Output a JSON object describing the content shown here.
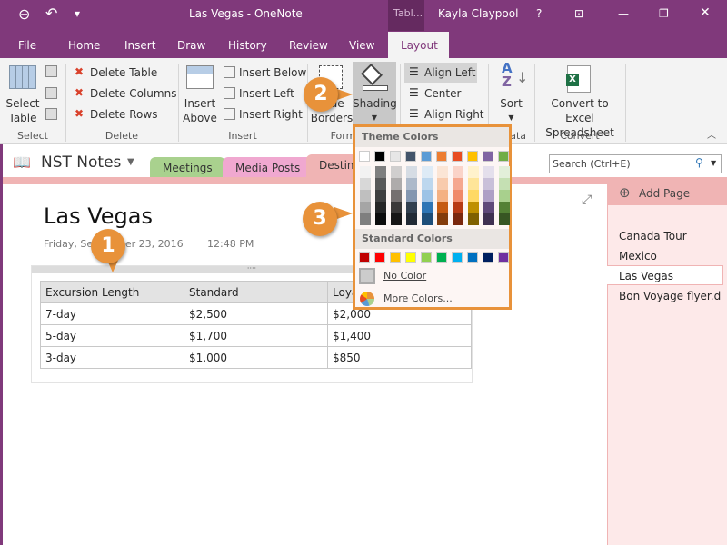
{
  "titlebar": {
    "title": "Las Vegas - OneNote",
    "context_tab": "Tabl...",
    "user": "Kayla Claypool",
    "help": "?"
  },
  "menu": [
    "File",
    "Home",
    "Insert",
    "Draw",
    "History",
    "Review",
    "View",
    "Layout"
  ],
  "ribbon": {
    "select": {
      "button": "Select Table",
      "group": "Select"
    },
    "delete": {
      "items": [
        "Delete Table",
        "Delete Columns",
        "Delete Rows"
      ],
      "group": "Delete"
    },
    "insert": {
      "above": "Insert Above",
      "items": [
        "Insert Below",
        "Insert Left",
        "Insert Right"
      ],
      "group": "Insert"
    },
    "format": {
      "borders": "Hide Borders",
      "shading": "Shading",
      "group": "Format"
    },
    "alignment": [
      "Align Left",
      "Center",
      "Align Right"
    ],
    "data": {
      "sort": "Sort",
      "group": "Data"
    },
    "convert": {
      "button": "Convert to Excel Spreadsheet",
      "group": "Convert"
    }
  },
  "notebook": {
    "name": "NST Notes",
    "sections": [
      "Meetings",
      "Media Posts",
      "Destinations"
    ],
    "search_placeholder": "Search (Ctrl+E)"
  },
  "page": {
    "title": "Las Vegas",
    "date": "Friday, September 23, 2016",
    "time": "12:48 PM"
  },
  "table": {
    "headers": [
      "Excursion Length",
      "Standard",
      "Loyalty"
    ],
    "rows": [
      [
        "7-day",
        "$2,500",
        "$2,000"
      ],
      [
        "5-day",
        "$1,700",
        "$1,400"
      ],
      [
        "3-day",
        "$1,000",
        "$850"
      ]
    ]
  },
  "pages": {
    "add": "Add Page",
    "items": [
      "Canada Tour",
      "Mexico",
      "Las Vegas",
      "Bon Voyage flyer.d"
    ],
    "selected": "Las Vegas"
  },
  "shading_menu": {
    "theme_label": "Theme Colors",
    "standard_label": "Standard Colors",
    "no_color": "No Color",
    "more_colors": "More Colors...",
    "theme": [
      "#ffffff",
      "#000000",
      "#e7e6e6",
      "#44546a",
      "#5b9bd5",
      "#ed7d31",
      "#e84c22",
      "#ffc000",
      "#8064a2",
      "#70ad47"
    ],
    "shades": [
      [
        "#f2f2f2",
        "#7f7f7f",
        "#d0cece",
        "#d6dce4",
        "#deebf6",
        "#fbe5d5",
        "#fad3c8",
        "#fff2cc",
        "#e4dfec",
        "#e2efd9"
      ],
      [
        "#d8d8d8",
        "#595959",
        "#aeabab",
        "#adb9ca",
        "#bdd7ee",
        "#f8cbad",
        "#f5a78f",
        "#fee599",
        "#c9c0d9",
        "#c5e0b3"
      ],
      [
        "#bfbfbf",
        "#3f3f3f",
        "#757070",
        "#8496b0",
        "#9dc3e6",
        "#f4b183",
        "#f08a6a",
        "#ffd965",
        "#ae9fc6",
        "#a8d08d"
      ],
      [
        "#a5a5a5",
        "#262626",
        "#3a3838",
        "#323f4f",
        "#2e75b5",
        "#c55a11",
        "#b73a14",
        "#bf9000",
        "#5f497a",
        "#538135"
      ],
      [
        "#7f7f7f",
        "#0c0c0c",
        "#171616",
        "#222a35",
        "#1e4e79",
        "#833c0b",
        "#7a270d",
        "#7f6000",
        "#3f3151",
        "#375623"
      ]
    ],
    "standard": [
      "#c00000",
      "#ff0000",
      "#ffc000",
      "#ffff00",
      "#92d050",
      "#00b050",
      "#00b0f0",
      "#0070c0",
      "#002060",
      "#7030a0"
    ]
  },
  "callouts": [
    "1",
    "2",
    "3"
  ],
  "colors": {
    "brand": "#80397b",
    "accent": "#e8923a",
    "section_pink": "#f0b4b4"
  }
}
